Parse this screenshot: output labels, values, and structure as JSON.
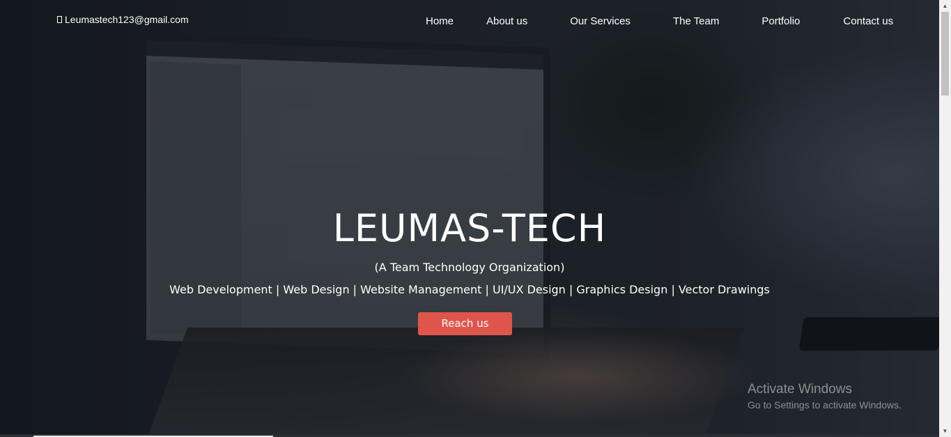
{
  "header": {
    "email": "Leumastech123@gmail.com",
    "email_icon": "envelope-icon"
  },
  "nav": {
    "items": [
      "Home",
      "About us",
      "Our Services",
      "The Team",
      "Portfolio",
      "Contact us"
    ]
  },
  "hero": {
    "title": "LEUMAS-TECH",
    "subtitle": "(A Team Technology Organization)",
    "services": "Web Development | Web Design | Website Management | UI/UX Design | Graphics Design | Vector Drawings",
    "cta_label": "Reach us"
  },
  "watermark": {
    "line1": "Activate Windows",
    "line2": "Go to Settings to activate Windows."
  },
  "colors": {
    "accent": "#e0554b",
    "text": "#ffffff"
  }
}
